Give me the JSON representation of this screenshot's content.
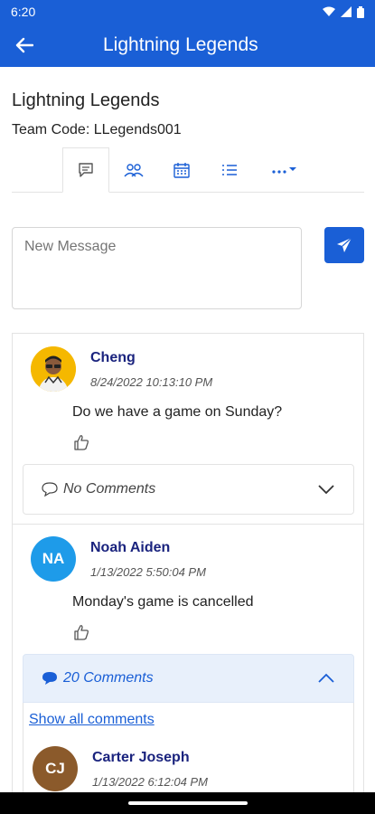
{
  "status_bar": {
    "time": "6:20"
  },
  "app_bar": {
    "title": "Lightning Legends"
  },
  "team": {
    "name": "Lightning Legends",
    "code_label": "Team Code: LLegends001"
  },
  "tabs": [
    {
      "icon": "chat-icon",
      "active": true
    },
    {
      "icon": "people-icon",
      "active": false
    },
    {
      "icon": "calendar-icon",
      "active": false
    },
    {
      "icon": "list-icon",
      "active": false
    },
    {
      "icon": "more-icon",
      "active": false
    }
  ],
  "composer": {
    "placeholder": "New Message"
  },
  "posts": [
    {
      "author": "Cheng",
      "timestamp": "8/24/2022 10:13:10 PM",
      "text": "Do we have a game on Sunday?",
      "comments_label": "No Comments"
    },
    {
      "author": "Noah Aiden",
      "initials": "NA",
      "timestamp": "1/13/2022 5:50:04 PM",
      "text": "Monday's game is cancelled",
      "comments_label": "20 Comments",
      "show_all_label": "Show all comments",
      "comment": {
        "author": "Carter Joseph",
        "initials": "CJ",
        "timestamp": "1/13/2022 6:12:04 PM"
      }
    }
  ],
  "colors": {
    "primary": "#1a5fd6",
    "name": "#1a237e",
    "avatar_na": "#1e9be9",
    "avatar_cj": "#8b5a2b"
  }
}
